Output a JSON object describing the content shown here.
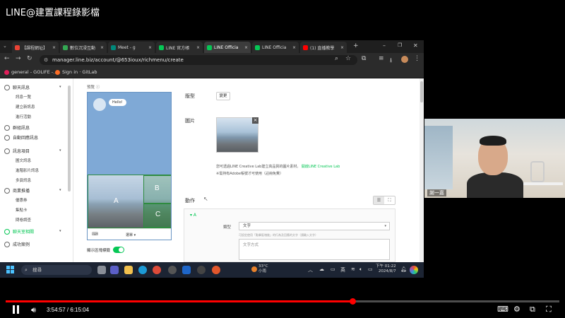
{
  "video": {
    "title": "LINE@建置課程錄影檔",
    "current_time": "3:54:57",
    "duration": "6:15:04",
    "progress_fraction": 0.626
  },
  "browser": {
    "tabs": [
      {
        "label": "【課程網址】",
        "color": "#ea4335"
      },
      {
        "label": "數位沉浸互動",
        "color": "#34a853"
      },
      {
        "label": "Meet - g",
        "color": "#00897b"
      },
      {
        "label": "LINE 官方帳",
        "color": "#06c755"
      },
      {
        "label": "LINE Officia",
        "color": "#06c755"
      },
      {
        "label": "LINE Officia",
        "color": "#06c755"
      },
      {
        "label": "(1) 直播教學",
        "color": "#ff0000"
      }
    ],
    "active_tab_index": 4,
    "url": "manager.line.biz/account/@653ioux/richmenu/create",
    "bookmarks": [
      {
        "label": "general - GOLIFE -...",
        "color": "#e01e5a"
      },
      {
        "label": "Sign in · GitLab",
        "color": "#fc6d26"
      }
    ]
  },
  "sidebar": {
    "sections": [
      {
        "label": "聊天訊息",
        "children": [
          "訊息一覽",
          "建立新訊息",
          "進行活動"
        ]
      },
      {
        "label": "群組訊息",
        "children": []
      },
      {
        "label": "自動回應訊息",
        "children": []
      },
      {
        "label": "訊息項目",
        "children": [
          "圖文訊息",
          "進階影片訊息",
          "多頁訊息"
        ]
      },
      {
        "label": "商業推播",
        "children": [
          "優惠券",
          "集點卡",
          "問卷調查"
        ]
      },
      {
        "label": "聊天室相關",
        "children": []
      },
      {
        "label": "成功案例",
        "children": []
      }
    ]
  },
  "preview": {
    "label": "預覽",
    "bubble_text": "Hello!",
    "areas": [
      "A",
      "B",
      "C"
    ],
    "menu_bar_label": "選單",
    "keyboard_icon": "keyboard-icon",
    "toggle_label": "顯示區塊標籤",
    "toggle_on": true
  },
  "form": {
    "layout_label": "版型",
    "layout_button": "變更",
    "image_label": "圖片",
    "image_note_prefix": "您可透過LINE Creative Lab建立高品質的圖片素材。",
    "image_note_link": "開啟LINE Creative Lab",
    "image_note2": "※需持有Adobe帳號才可使用（註冊免費）",
    "action_label": "動作",
    "action_area": "A",
    "type_label": "類型",
    "type_value": "文字",
    "type_hint": "可設定使用「點擊區塊後」的行為及回應的文字（請輸入文字）",
    "text_placeholder": "文字方式"
  },
  "taskbar": {
    "search_placeholder": "搜尋",
    "weather_temp": "33°C",
    "weather_desc": "小雨",
    "ime": "英",
    "time": "下午 01:22",
    "date": "2024/8/7"
  },
  "webcam": {
    "name": "謝一嘉"
  }
}
